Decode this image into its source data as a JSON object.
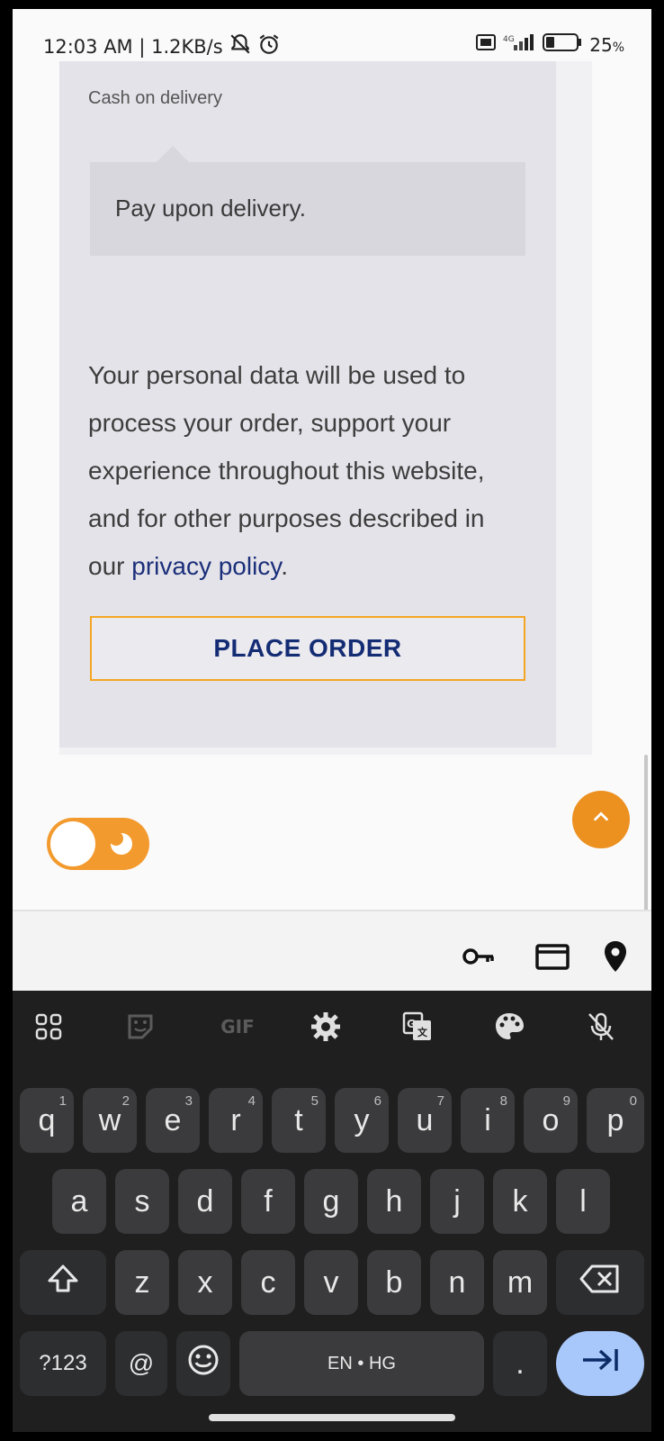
{
  "status_bar": {
    "time_speed": "12:03 AM | 1.2KB/s",
    "battery": "25",
    "battery_unit": "%",
    "icons": [
      "mute-icon",
      "alarm-icon",
      "volte-icon",
      "signal-icon",
      "battery-icon"
    ]
  },
  "checkout": {
    "payment_method": "Cash on delivery",
    "payment_description": "Pay upon delivery.",
    "privacy_text": "Your personal data will be used to process your order, support your experience throughout this website, and for other purposes described in our ",
    "privacy_link": "privacy policy",
    "privacy_end": ".",
    "place_order_label": "PLACE ORDER"
  },
  "controls": {
    "scroll_top_icon": "chevron-up-icon",
    "theme_toggle_icon": "moon-icon"
  },
  "autofill_bar": {
    "icons": [
      "key-icon",
      "card-icon",
      "location-icon"
    ]
  },
  "keyboard": {
    "toolbar": [
      "apps-icon",
      "sticker-icon",
      "GIF",
      "settings-icon",
      "translate-icon",
      "palette-icon",
      "mic-off-icon"
    ],
    "row1": [
      {
        "k": "q",
        "s": "1"
      },
      {
        "k": "w",
        "s": "2"
      },
      {
        "k": "e",
        "s": "3"
      },
      {
        "k": "r",
        "s": "4"
      },
      {
        "k": "t",
        "s": "5"
      },
      {
        "k": "y",
        "s": "6"
      },
      {
        "k": "u",
        "s": "7"
      },
      {
        "k": "i",
        "s": "8"
      },
      {
        "k": "o",
        "s": "9"
      },
      {
        "k": "p",
        "s": "0"
      }
    ],
    "row2": [
      "a",
      "s",
      "d",
      "f",
      "g",
      "h",
      "j",
      "k",
      "l"
    ],
    "row3": [
      "z",
      "x",
      "c",
      "v",
      "b",
      "n",
      "m"
    ],
    "bottom": {
      "symbols": "?123",
      "at": "@",
      "emoji_icon": "emoji-icon",
      "space": "EN • HG",
      "period": ".",
      "enter_icon": "tab-arrow-icon"
    },
    "gif_label": "GIF"
  }
}
